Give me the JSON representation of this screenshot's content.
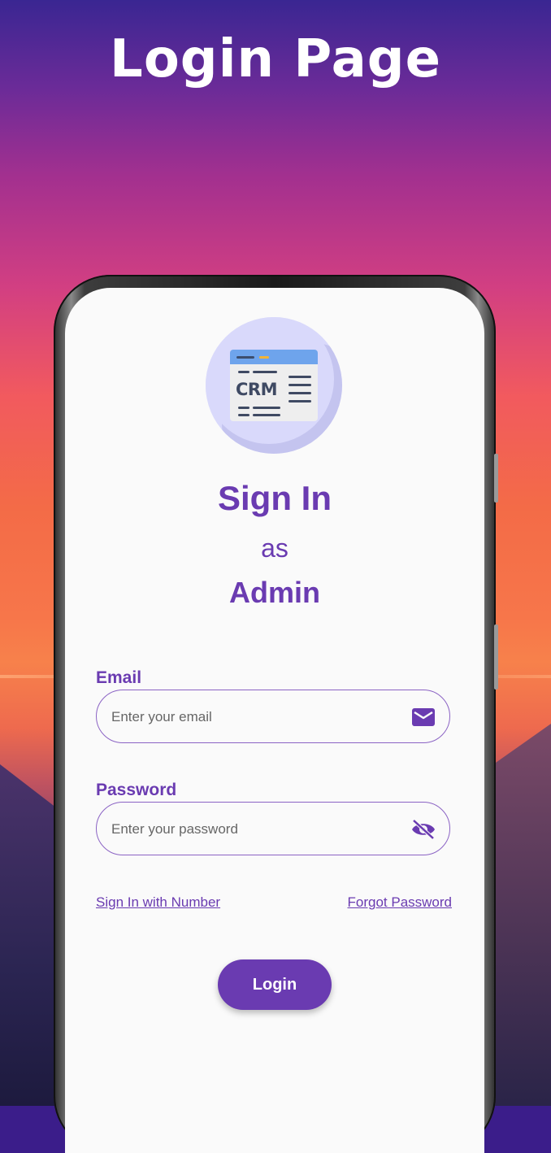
{
  "header": {
    "title": "Login Page"
  },
  "logo": {
    "text": "CRM"
  },
  "heading": {
    "line1": "Sign In",
    "line2": "as",
    "line3": "Admin"
  },
  "email": {
    "label": "Email",
    "placeholder": "Enter your email",
    "icon": "mail-icon"
  },
  "password": {
    "label": "Password",
    "placeholder": "Enter your password",
    "icon": "eye-off-icon"
  },
  "links": {
    "sign_in_number": "Sign In with Number",
    "forgot_password": "Forgot Password"
  },
  "login_button": {
    "label": "Login"
  },
  "colors": {
    "accent": "#6a3bb1",
    "screen_bg": "#fafafa",
    "logo_circle": "#d9d9fb"
  }
}
